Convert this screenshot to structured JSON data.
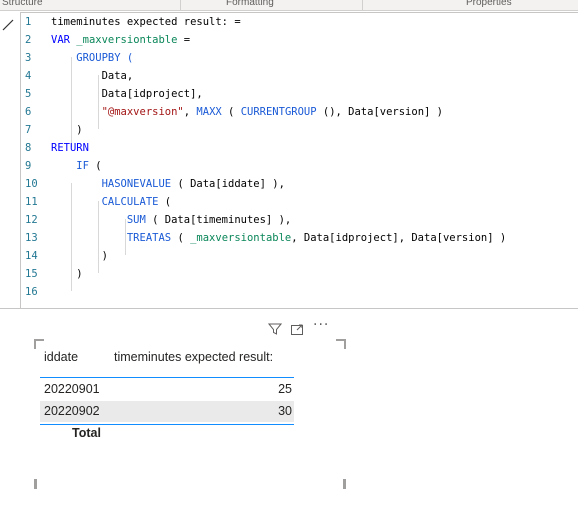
{
  "tabs": [
    "Structure",
    "Formatting",
    "Properties"
  ],
  "formula": {
    "lines": [
      {
        "n": "1",
        "tokens": [
          {
            "t": "timeminutes expected result: =",
            "c": "plain"
          }
        ]
      },
      {
        "n": "2",
        "tokens": [
          {
            "t": "VAR ",
            "c": "kw"
          },
          {
            "t": "_maxversiontable",
            "c": "var"
          },
          {
            "t": " =",
            "c": "plain"
          }
        ]
      },
      {
        "n": "3",
        "tokens": [
          {
            "t": "    GROUPBY (",
            "c": "fn"
          }
        ]
      },
      {
        "n": "4",
        "tokens": [
          {
            "t": "        Data,",
            "c": "plain"
          }
        ]
      },
      {
        "n": "5",
        "tokens": [
          {
            "t": "        Data[idproject],",
            "c": "plain"
          }
        ]
      },
      {
        "n": "6",
        "tokens": [
          {
            "t": "        ",
            "c": "plain"
          },
          {
            "t": "\"@maxversion\"",
            "c": "str"
          },
          {
            "t": ", ",
            "c": "plain"
          },
          {
            "t": "MAXX",
            "c": "fn"
          },
          {
            "t": " ( ",
            "c": "plain"
          },
          {
            "t": "CURRENTGROUP",
            "c": "fn"
          },
          {
            "t": " (), Data[version] )",
            "c": "plain"
          }
        ]
      },
      {
        "n": "7",
        "tokens": [
          {
            "t": "    )",
            "c": "plain"
          }
        ]
      },
      {
        "n": "8",
        "tokens": [
          {
            "t": "RETURN",
            "c": "kw"
          }
        ]
      },
      {
        "n": "9",
        "tokens": [
          {
            "t": "    ",
            "c": "plain"
          },
          {
            "t": "IF",
            "c": "fn"
          },
          {
            "t": " (",
            "c": "plain"
          }
        ]
      },
      {
        "n": "10",
        "tokens": [
          {
            "t": "        ",
            "c": "plain"
          },
          {
            "t": "HASONEVALUE",
            "c": "fn"
          },
          {
            "t": " ( Data[iddate] ),",
            "c": "plain"
          }
        ]
      },
      {
        "n": "11",
        "tokens": [
          {
            "t": "        ",
            "c": "plain"
          },
          {
            "t": "CALCULATE",
            "c": "fn"
          },
          {
            "t": " (",
            "c": "plain"
          }
        ]
      },
      {
        "n": "12",
        "tokens": [
          {
            "t": "            ",
            "c": "plain"
          },
          {
            "t": "SUM",
            "c": "fn"
          },
          {
            "t": " ( Data[timeminutes] ),",
            "c": "plain"
          }
        ]
      },
      {
        "n": "13",
        "tokens": [
          {
            "t": "            ",
            "c": "plain"
          },
          {
            "t": "TREATAS",
            "c": "fn"
          },
          {
            "t": " ( ",
            "c": "plain"
          },
          {
            "t": "_maxversiontable",
            "c": "var"
          },
          {
            "t": ", Data[idproject], Data[version] )",
            "c": "plain"
          }
        ]
      },
      {
        "n": "14",
        "tokens": [
          {
            "t": "        )",
            "c": "plain"
          }
        ]
      },
      {
        "n": "15",
        "tokens": [
          {
            "t": "    )",
            "c": "plain"
          }
        ]
      },
      {
        "n": "16",
        "tokens": []
      }
    ]
  },
  "visual_header": {
    "filter_icon": "filter-icon",
    "focus_icon": "focus-mode-icon",
    "more_icon": "more-options-icon",
    "more_text": "···"
  },
  "table": {
    "headers": [
      "iddate",
      "timeminutes expected result:"
    ],
    "rows": [
      {
        "date": "20220901",
        "value": "25"
      },
      {
        "date": "20220902",
        "value": "30"
      }
    ],
    "total_label": "Total"
  },
  "colors": {
    "accent": "#118dff",
    "keyword": "#0000ff",
    "function": "#1a5ad6",
    "string": "#a31515",
    "variable": "#098658",
    "line_number": "#237893",
    "row_alt": "#eaeaea"
  }
}
